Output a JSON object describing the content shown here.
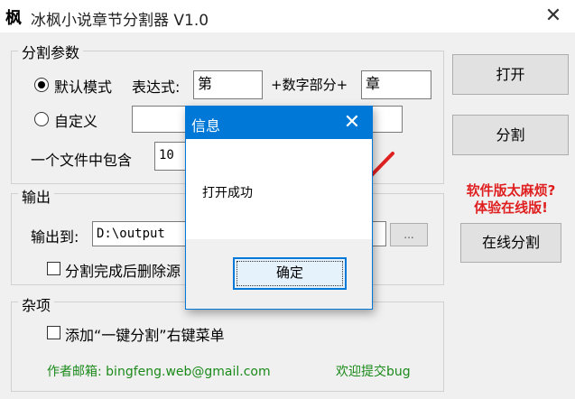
{
  "window": {
    "logo": "枫",
    "title": "冰枫小说章节分割器 V1.0",
    "close_glyph": "✕"
  },
  "split_params": {
    "group_label": "分割参数",
    "default_mode_label": "默认模式",
    "default_mode_selected": true,
    "expression_label": "表达式:",
    "prefix_value": "第",
    "number_part_label": "+数字部分+",
    "suffix_value": "章",
    "custom_label": "自定义",
    "custom_value": "",
    "per_file_label": "一个文件中包含",
    "per_file_value": "10"
  },
  "output": {
    "group_label": "输出",
    "output_to_label": "输出到:",
    "output_path": "D:\\output",
    "browse_label": "...",
    "delete_after_label": "分割完成后删除源",
    "delete_after_checked": false
  },
  "misc": {
    "group_label": "杂项",
    "context_menu_label": "添加“一键分割”右键菜单",
    "context_menu_checked": false
  },
  "buttons": {
    "open": "打开",
    "split": "分割",
    "online_split": "在线分割"
  },
  "promo": {
    "line1": "软件版太麻烦?",
    "line2": "体验在线版!"
  },
  "footer": {
    "email_label": "作者邮箱: bingfeng.web@gmail.com",
    "bug_label": "欢迎提交bug"
  },
  "dialog": {
    "title": "信息",
    "close_glyph": "✕",
    "message": "打开成功",
    "ok_label": "确定"
  },
  "annotation": {
    "arrow_color": "#e02020"
  }
}
